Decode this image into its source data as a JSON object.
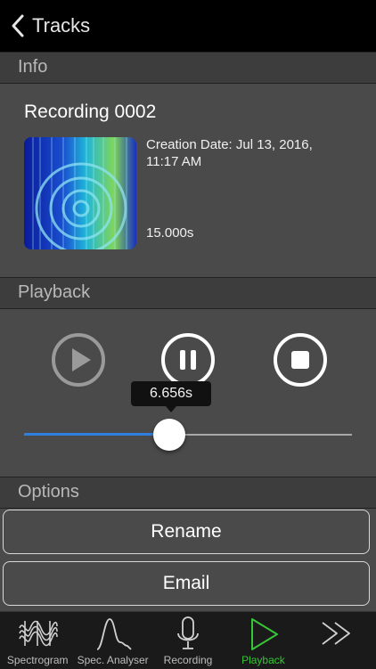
{
  "nav": {
    "back_label": "Tracks"
  },
  "info": {
    "header": "Info",
    "title": "Recording 0002",
    "creation_line1": "Creation Date: Jul 13, 2016,",
    "creation_line2": "11:17 AM",
    "duration": "15.000s"
  },
  "playback": {
    "header": "Playback",
    "position_label": "6.656s",
    "position_seconds": 6.656,
    "length_seconds": 15.0
  },
  "options": {
    "header": "Options",
    "rename_label": "Rename",
    "email_label": "Email"
  },
  "tabs": [
    {
      "label": "Spectrogram",
      "icon": "waveform-icon"
    },
    {
      "label": "Spec. Analyser",
      "icon": "spectrum-peak-icon"
    },
    {
      "label": "Recording",
      "icon": "microphone-icon"
    },
    {
      "label": "Playback",
      "icon": "play-outline-icon",
      "active": true
    },
    {
      "label": "",
      "icon": "double-chevron-right-icon"
    }
  ],
  "colors": {
    "accent_blue": "#2e7fe0",
    "active_tab": "#37c437",
    "background": "#4a4a4a"
  }
}
